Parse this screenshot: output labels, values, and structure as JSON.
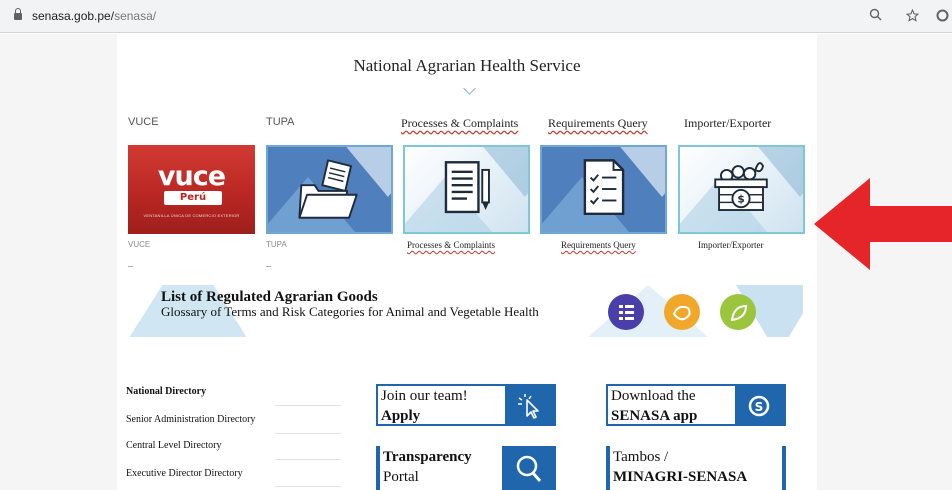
{
  "browser": {
    "url_host": "senasa.gob.pe/",
    "url_path": "senasa/",
    "icons": [
      "lock-icon",
      "zoom-icon",
      "star-icon",
      "extension-icon"
    ]
  },
  "page": {
    "title": "National Agrarian Health Service"
  },
  "tiles": [
    {
      "top_label": "VUCE",
      "bottom_label": "VUCE",
      "icon": "vuce-logo"
    },
    {
      "top_label": "TUPA",
      "bottom_label": "TUPA",
      "icon": "folder-icon"
    },
    {
      "top_label": "Processes & Complaints",
      "bottom_label": "Processes & Complaints",
      "icon": "document-pen-icon"
    },
    {
      "top_label": "Requirements Query",
      "bottom_label": "Requirements Query",
      "icon": "checklist-icon"
    },
    {
      "top_label": "Importer/Exporter",
      "bottom_label": "Importer/Exporter",
      "icon": "produce-crate-icon"
    }
  ],
  "vuce_logo": {
    "word": "vuce",
    "country": "Perú",
    "subtitle": "VENTANILLA ÚNICA DE COMERCIO EXTERIOR"
  },
  "banner": {
    "title": "List of Regulated Agrarian Goods",
    "subtitle": "Glossary of Terms and Risk Categories for Animal and Vegetable Health"
  },
  "directory": [
    {
      "label": "National Directory",
      "bold": true
    },
    {
      "label": "Senior Administration Directory",
      "bold": false
    },
    {
      "label": "Central Level Directory",
      "bold": false
    },
    {
      "label": "Executive Director Directory",
      "bold": false
    }
  ],
  "boxes": {
    "join": {
      "line1": "Join our team!",
      "line2": "Apply"
    },
    "download": {
      "line1": "Download the",
      "line2": "SENASA app"
    },
    "transparency": {
      "line1": "Transparency",
      "line2": "Portal"
    },
    "tambos": {
      "line1": "Tambos /",
      "line2": "MINAGRI-SENASA"
    }
  },
  "colors": {
    "accent_blue": "#1f66ad",
    "tile_border": "#7ec7d6",
    "arrow_red": "#e5252a",
    "vuce_red": "#c1302a"
  }
}
